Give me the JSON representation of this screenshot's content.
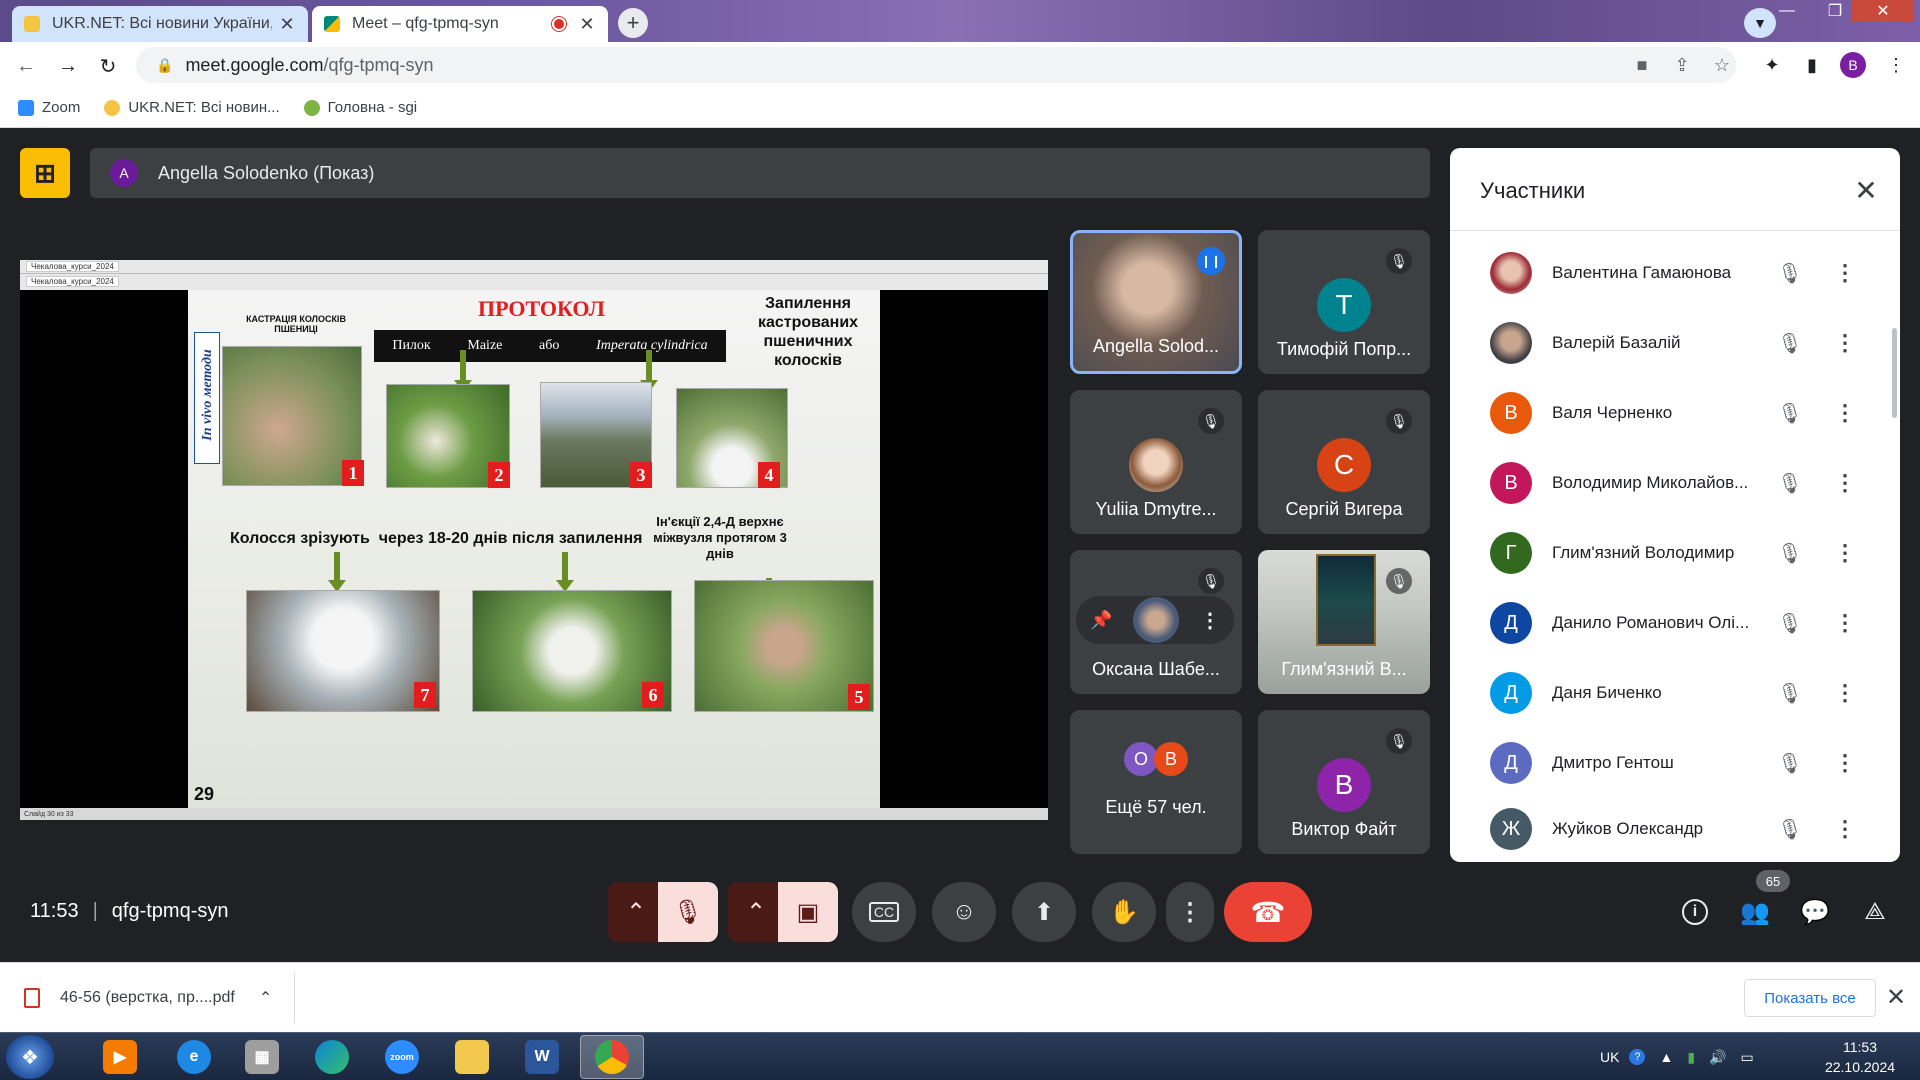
{
  "browser": {
    "tabs": [
      {
        "title": "UKR.NET: Всі новини України, ос",
        "favicon_color": "#f6c445",
        "active": false
      },
      {
        "title": "Meet – qfg-tpmq-syn",
        "favicon_color": "#00897b",
        "active": true
      }
    ],
    "new_tab": "+",
    "url_host": "meet.google.com",
    "url_path": "/qfg-tpmq-syn",
    "profile_initial": "B",
    "bookmarks": [
      {
        "label": "Zoom",
        "color": "#2d8cff"
      },
      {
        "label": "UKR.NET: Всі новин...",
        "color": "#f6c445"
      },
      {
        "label": "Головна - sgi",
        "color": "#7cb342"
      }
    ]
  },
  "meet": {
    "presenter_label": "Angella Solodenko (Показ)",
    "presenter_initial": "A",
    "slide": {
      "title": "ПРОТОКОЛ",
      "left_caption": "КАСТРАЦІЯ КОЛОСКІВ ПШЕНИЦІ",
      "vertical_label": "In vivo методи",
      "pollen_row": [
        "Пилок",
        "Maize",
        "або",
        "Imperata cylindrica"
      ],
      "pollination_caption": "Запилення кастрованих пшеничних колосків",
      "cut_caption": "Колосся зрізують  через 18-20 днів після запилення",
      "injection_caption": "Ін'єкції 2,4-Д верхнє міжвузля протягом 3 днів",
      "page_number": "29",
      "photo_numbers": [
        "1",
        "2",
        "3",
        "4",
        "7",
        "6",
        "5"
      ],
      "ui_tab_label": "Чекалова_курси_2024",
      "ui_status": "Слайд 30 из 33"
    },
    "tiles": [
      {
        "name": "Angella Solod...",
        "type": "video",
        "speaking": true
      },
      {
        "name": "Тимофій Попр...",
        "initial": "T",
        "color": "#00838f",
        "muted": true
      },
      {
        "name": "Yuliia Dmytre...",
        "type": "photo",
        "muted": true
      },
      {
        "name": "Сергій Вигера",
        "initial": "C",
        "color": "#d84315",
        "muted": true
      },
      {
        "name": "Оксана Шабе...",
        "type": "photo-small",
        "muted": true
      },
      {
        "name": "Глим'язний В...",
        "type": "video",
        "muted": true
      },
      {
        "name": "Ещё 57 чел.",
        "initials": [
          "O",
          "B"
        ]
      },
      {
        "name": "Виктор Файт",
        "initial": "B",
        "color": "#8e24aa",
        "muted": true
      }
    ],
    "panel": {
      "title": "Участники",
      "participants": [
        {
          "name": "Валентина Гамаюнова",
          "initial": "",
          "color": "#9c6b5a"
        },
        {
          "name": "Валерій Базалій",
          "initial": "",
          "color": "#5f6368"
        },
        {
          "name": "Валя Черненко",
          "initial": "В",
          "color": "#e8590c"
        },
        {
          "name": "Володимир Миколайов...",
          "initial": "В",
          "color": "#c2185b"
        },
        {
          "name": "Глим'язний Володимир",
          "initial": "Г",
          "color": "#33691e"
        },
        {
          "name": "Данило Романович Олі...",
          "initial": "Д",
          "color": "#0d47a1"
        },
        {
          "name": "Даня Биченко",
          "initial": "Д",
          "color": "#039be5"
        },
        {
          "name": "Дмитро Гентош",
          "initial": "Д",
          "color": "#5c6bc0"
        },
        {
          "name": "Жуйков Олександр",
          "initial": "Ж",
          "color": "#455a64"
        }
      ]
    },
    "time": "11:53",
    "meeting_code": "qfg-tpmq-syn",
    "participant_count": "65"
  },
  "downloads": {
    "file": "46-56 (верстка, пр....pdf",
    "show_all": "Показать все"
  },
  "taskbar": {
    "lang": "UK",
    "time": "11:53",
    "date": "22.10.2024"
  }
}
